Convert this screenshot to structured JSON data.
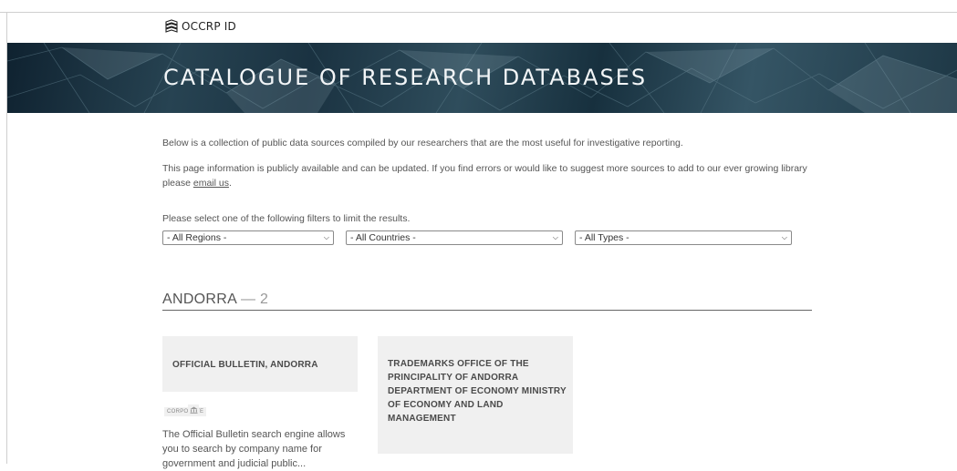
{
  "header": {
    "logo_text": "OCCRP ID"
  },
  "banner": {
    "title": "CATALOGUE OF RESEARCH DATABASES"
  },
  "intro": {
    "line1": "Below is a collection of public data sources compiled by our researchers that are the most useful for investigative reporting.",
    "line2_prefix": "This page information is publicly available and can be updated. If you find errors or would like to suggest more sources to add to our ever growing library please ",
    "email_link": "email us",
    "line2_suffix": ".",
    "filter_prompt": "Please select one of the following filters to limit the results."
  },
  "filters": {
    "regions": "- All Regions -",
    "countries": "- All Countries -",
    "types": "- All Types -"
  },
  "section": {
    "name": "ANDORRA",
    "separator": " — ",
    "count": "2"
  },
  "cards": [
    {
      "title": "OFFICIAL BULLETIN, ANDORRA",
      "tag": "CORPORATE",
      "icon": "building-icon",
      "description": "The Official Bulletin search engine allows you to search by company name for government and judicial public..."
    },
    {
      "title": "TRADEMARKS OFFICE OF THE PRINCIPALITY OF ANDORRA DEPARTMENT OF ECONOMY MINISTRY OF ECONOMY AND LAND MANAGEMENT"
    }
  ],
  "colors": {
    "banner": "#1f3a48",
    "card_bg": "#f0f0f0",
    "text": "#555555"
  }
}
